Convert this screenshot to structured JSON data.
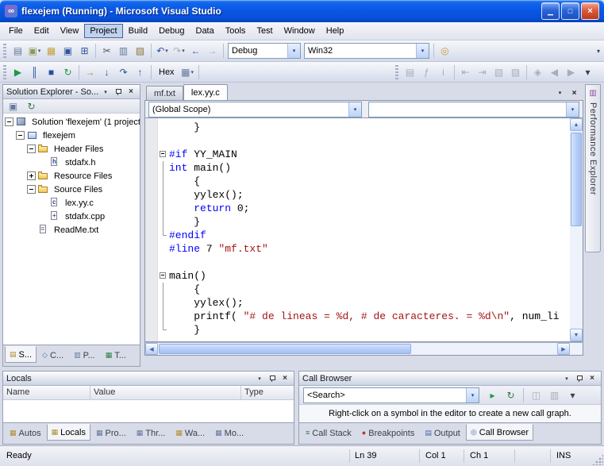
{
  "glyphs": {
    "dropdown": "▾",
    "overflow": "▾",
    "close_x": "×",
    "up": "▲",
    "down": "▼",
    "left": "◀",
    "right": "▶"
  },
  "window": {
    "icon_glyph": "∞",
    "title": "flexejem (Running) - Microsoft Visual Studio",
    "minimize": "▁",
    "maximize": "□",
    "close": "×"
  },
  "menu": {
    "items": [
      "File",
      "Edit",
      "View",
      "Project",
      "Build",
      "Debug",
      "Data",
      "Tools",
      "Test",
      "Window",
      "Help"
    ],
    "active_index": 3
  },
  "toolbar_standard": [
    {
      "type": "grip"
    },
    {
      "type": "btn",
      "name": "new-project-icon",
      "glyph": "▤",
      "color": "#67779f"
    },
    {
      "type": "btn",
      "name": "add-new-item-icon",
      "glyph": "▣",
      "color": "#8d9a55",
      "dropdown": true
    },
    {
      "type": "btn",
      "name": "open-file-icon",
      "glyph": "▦",
      "color": "#c9a03c"
    },
    {
      "type": "btn",
      "name": "save-icon",
      "glyph": "▣",
      "color": "#33549b"
    },
    {
      "type": "btn",
      "name": "save-all-icon",
      "glyph": "⊞",
      "color": "#33549b"
    },
    {
      "type": "sep"
    },
    {
      "type": "btn",
      "name": "cut-icon",
      "glyph": "✂",
      "color": "#51555e"
    },
    {
      "type": "btn",
      "name": "copy-icon",
      "glyph": "▥",
      "color": "#67779f"
    },
    {
      "type": "btn",
      "name": "paste-icon",
      "glyph": "▨",
      "color": "#8a753c"
    },
    {
      "type": "sep"
    },
    {
      "type": "btn",
      "name": "undo-icon",
      "glyph": "↶",
      "color": "#2b4ea0",
      "dropdown": true
    },
    {
      "type": "btn",
      "name": "redo-icon",
      "glyph": "↷",
      "disabled": true,
      "dropdown": true
    },
    {
      "type": "btn",
      "name": "navigate-backward-icon",
      "glyph": "←",
      "color": "#2b4ea0"
    },
    {
      "type": "btn",
      "name": "navigate-forward-icon",
      "glyph": "→",
      "disabled": true
    },
    {
      "type": "sep"
    },
    {
      "type": "combo",
      "name": "solution-config-combo",
      "label": "Debug"
    },
    {
      "type": "combo",
      "name": "platform-combo",
      "label": "Win32"
    },
    {
      "type": "sep"
    },
    {
      "type": "btn",
      "name": "find-in-files-icon",
      "glyph": "◎",
      "color": "#c9a03c"
    }
  ],
  "toolbar_debug": [
    {
      "type": "grip"
    },
    {
      "type": "btn",
      "name": "continue-icon",
      "glyph": "▶",
      "color": "#1d9a3f"
    },
    {
      "type": "btn",
      "name": "break-all-icon",
      "glyph": "║",
      "color": "#2b4ea0"
    },
    {
      "type": "btn",
      "name": "stop-debugging-icon",
      "glyph": "■",
      "color": "#2b4ea0"
    },
    {
      "type": "btn",
      "name": "restart-icon",
      "glyph": "↻",
      "color": "#1d9a3f"
    },
    {
      "type": "sep"
    },
    {
      "type": "btn",
      "name": "show-next-statement-icon",
      "glyph": "→",
      "color": "#b58a1e"
    },
    {
      "type": "btn",
      "name": "step-into-icon",
      "glyph": "↓",
      "color": "#2b4ea0"
    },
    {
      "type": "btn",
      "name": "step-over-icon",
      "glyph": "↷",
      "color": "#2b4ea0"
    },
    {
      "type": "btn",
      "name": "step-out-icon",
      "glyph": "↑",
      "color": "#2b4ea0"
    },
    {
      "type": "sep"
    },
    {
      "type": "label",
      "name": "hex-toggle-button",
      "label": "Hex"
    },
    {
      "type": "btn",
      "name": "memory-window-icon",
      "glyph": "▦",
      "color": "#67779f",
      "dropdown": true
    },
    {
      "type": "sep"
    }
  ],
  "toolbar_text_editor": [
    {
      "type": "grip"
    },
    {
      "type": "btn",
      "name": "member-list-icon",
      "glyph": "▤",
      "disabled": true
    },
    {
      "type": "btn",
      "name": "parameter-info-icon",
      "glyph": "ƒ",
      "disabled": true
    },
    {
      "type": "btn",
      "name": "quick-info-icon",
      "glyph": "i",
      "disabled": true
    },
    {
      "type": "sep"
    },
    {
      "type": "btn",
      "name": "decrease-indent-icon",
      "glyph": "⇤",
      "disabled": true
    },
    {
      "type": "btn",
      "name": "increase-indent-icon",
      "glyph": "⇥",
      "disabled": true
    },
    {
      "type": "btn",
      "name": "comment-out-icon",
      "glyph": "▧",
      "disabled": true
    },
    {
      "type": "btn",
      "name": "uncomment-icon",
      "glyph": "▨",
      "disabled": true
    },
    {
      "type": "sep"
    },
    {
      "type": "btn",
      "name": "toggle-bookmark-icon",
      "glyph": "◈",
      "disabled": true
    },
    {
      "type": "btn",
      "name": "prev-bookmark-icon",
      "glyph": "◀",
      "disabled": true
    },
    {
      "type": "btn",
      "name": "next-bookmark-icon",
      "glyph": "▶",
      "disabled": true
    },
    {
      "type": "btn",
      "name": "toolbar-options-icon",
      "glyph": "▾",
      "color": "#3a4050"
    }
  ],
  "solution_explorer": {
    "title": "Solution Explorer - So...",
    "toolbar": [
      {
        "type": "btn",
        "name": "properties-icon",
        "glyph": "▣",
        "color": "#67779f"
      },
      {
        "type": "btn",
        "name": "refresh-icon",
        "glyph": "↻",
        "color": "#2e7d46"
      }
    ],
    "tree": [
      {
        "label": "Solution 'flexejem' (1 project)",
        "level": 0,
        "expand": "minus",
        "icon": "solution"
      },
      {
        "label": "flexejem",
        "level": 1,
        "expand": "minus",
        "icon": "project"
      },
      {
        "label": "Header Files",
        "level": 2,
        "expand": "minus",
        "icon": "folder"
      },
      {
        "label": "stdafx.h",
        "level": 3,
        "expand": "none",
        "icon": "file-h"
      },
      {
        "label": "Resource Files",
        "level": 2,
        "expand": "plus",
        "icon": "folder"
      },
      {
        "label": "Source Files",
        "level": 2,
        "expand": "minus",
        "icon": "folder"
      },
      {
        "label": "lex.yy.c",
        "level": 3,
        "expand": "none",
        "icon": "file-c"
      },
      {
        "label": "stdafx.cpp",
        "level": 3,
        "expand": "none",
        "icon": "file-cpp"
      },
      {
        "label": "ReadMe.txt",
        "level": 2,
        "expand": "none",
        "icon": "file-txt"
      }
    ],
    "tabs": [
      {
        "label": "S...",
        "icon": "solution-explorer-tab-icon",
        "glyph": "▤",
        "color": "#b08d2f",
        "active": true
      },
      {
        "label": "C...",
        "icon": "class-view-tab-icon",
        "glyph": "◇",
        "color": "#4a66b0"
      },
      {
        "label": "P...",
        "icon": "property-manager-tab-icon",
        "glyph": "▥",
        "color": "#67779f"
      },
      {
        "label": "T...",
        "icon": "team-explorer-tab-icon",
        "glyph": "▦",
        "color": "#2e7d46"
      }
    ]
  },
  "editor": {
    "tabs": [
      {
        "label": "mf.txt",
        "active": false
      },
      {
        "label": "lex.yy.c",
        "active": true
      }
    ],
    "scope_combo": "(Global Scope)",
    "member_combo": "",
    "code": {
      "lines": [
        {
          "fold": "none",
          "segs": [
            {
              "t": "    }",
              "c": "p"
            }
          ]
        },
        {
          "fold": "none",
          "segs": []
        },
        {
          "fold": "minus",
          "segs": [
            {
              "t": "#if",
              "c": "k"
            },
            {
              "t": " YY_MAIN",
              "c": "p"
            }
          ]
        },
        {
          "fold": "line",
          "segs": [
            {
              "t": "int",
              "c": "k"
            },
            {
              "t": " main()",
              "c": "p"
            }
          ]
        },
        {
          "fold": "line",
          "segs": [
            {
              "t": "    {",
              "c": "p"
            }
          ]
        },
        {
          "fold": "line",
          "segs": [
            {
              "t": "    yylex();",
              "c": "p"
            }
          ]
        },
        {
          "fold": "line",
          "segs": [
            {
              "t": "    ",
              "c": "p"
            },
            {
              "t": "return",
              "c": "k"
            },
            {
              "t": " 0;",
              "c": "p"
            }
          ]
        },
        {
          "fold": "line",
          "segs": [
            {
              "t": "    }",
              "c": "p"
            }
          ]
        },
        {
          "fold": "end",
          "segs": [
            {
              "t": "#endif",
              "c": "k"
            }
          ]
        },
        {
          "fold": "none",
          "segs": [
            {
              "t": "#line",
              "c": "k"
            },
            {
              "t": " 7 ",
              "c": "p"
            },
            {
              "t": "\"mf.txt\"",
              "c": "s"
            }
          ]
        },
        {
          "fold": "none",
          "segs": []
        },
        {
          "fold": "minus",
          "segs": [
            {
              "t": "main()",
              "c": "p"
            }
          ]
        },
        {
          "fold": "line",
          "segs": [
            {
              "t": "    {",
              "c": "p"
            }
          ]
        },
        {
          "fold": "line",
          "segs": [
            {
              "t": "    yylex();",
              "c": "p"
            }
          ]
        },
        {
          "fold": "line",
          "segs": [
            {
              "t": "    printf( ",
              "c": "p"
            },
            {
              "t": "\"# de lineas = %d, # de caracteres. = %d\\n\"",
              "c": "s"
            },
            {
              "t": ", num_li",
              "c": "p"
            }
          ]
        },
        {
          "fold": "end",
          "segs": [
            {
              "t": "    }",
              "c": "p"
            }
          ]
        }
      ]
    }
  },
  "performance_explorer": {
    "icon_glyph": "▥",
    "label": "Performance Explorer"
  },
  "locals": {
    "title": "Locals",
    "columns": [
      "Name",
      "Value",
      "Type"
    ],
    "tabs": [
      {
        "label": "Autos",
        "icon": "autos-tab-icon",
        "glyph": "▦",
        "color": "#b08d2f"
      },
      {
        "label": "Locals",
        "icon": "locals-tab-icon",
        "glyph": "▦",
        "color": "#b08d2f",
        "active": true
      },
      {
        "label": "Pro...",
        "icon": "processes-tab-icon",
        "glyph": "▦",
        "color": "#67779f"
      },
      {
        "label": "Thr...",
        "icon": "threads-tab-icon",
        "glyph": "▦",
        "color": "#67779f"
      },
      {
        "label": "Wa...",
        "icon": "watch-tab-icon",
        "glyph": "▦",
        "color": "#b08d2f"
      },
      {
        "label": "Mo...",
        "icon": "modules-tab-icon",
        "glyph": "▦",
        "color": "#67779f"
      }
    ]
  },
  "call_browser": {
    "title": "Call Browser",
    "toolbar": [
      {
        "type": "combo",
        "name": "search-combo",
        "label": "<Search>"
      },
      {
        "type": "btn",
        "name": "search-go-icon",
        "glyph": "▸",
        "color": "#1d9a3f"
      },
      {
        "type": "btn",
        "name": "refresh-icon",
        "glyph": "↻",
        "color": "#2e7d46"
      },
      {
        "type": "sep"
      },
      {
        "type": "btn",
        "name": "show-call-graph-icon",
        "glyph": "◫",
        "disabled": true
      },
      {
        "type": "btn",
        "name": "toggle-details-icon",
        "glyph": "▥",
        "disabled": true
      },
      {
        "type": "btn",
        "name": "toolbar-options-icon",
        "glyph": "▾",
        "color": "#3a4050"
      }
    ],
    "hint": "Right-click on a symbol in the editor to create a new call graph.",
    "tabs": [
      {
        "label": "Call Stack",
        "icon": "call-stack-tab-icon",
        "glyph": "≡",
        "color": "#2e7d46"
      },
      {
        "label": "Breakpoints",
        "icon": "breakpoints-tab-icon",
        "glyph": "●",
        "color": "#b03a2e"
      },
      {
        "label": "Output",
        "icon": "output-tab-icon",
        "glyph": "▤",
        "color": "#4a66b0"
      },
      {
        "label": "Call Browser",
        "icon": "call-browser-tab-icon",
        "glyph": "◎",
        "color": "#4a66b0",
        "active": true
      }
    ]
  },
  "status_bar": {
    "ready": "Ready",
    "ln": "Ln 39",
    "col": "Col 1",
    "ch": "Ch 1",
    "ins": "INS"
  }
}
